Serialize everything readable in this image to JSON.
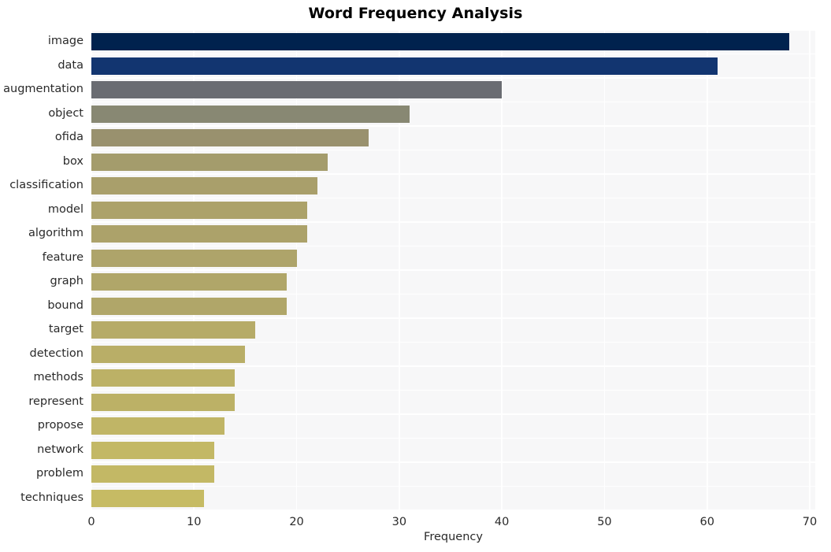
{
  "chart": {
    "title": "Word Frequency Analysis",
    "xlabel": "Frequency",
    "ylabel": ""
  },
  "chart_data": {
    "type": "bar",
    "orientation": "horizontal",
    "title": "Word Frequency Analysis",
    "xlabel": "Frequency",
    "ylabel": "",
    "xlim": [
      0,
      70
    ],
    "xticks": [
      0,
      10,
      20,
      30,
      40,
      50,
      60,
      70
    ],
    "grid": true,
    "legend": null,
    "categories": [
      "image",
      "data",
      "augmentation",
      "object",
      "ofida",
      "box",
      "classification",
      "model",
      "algorithm",
      "feature",
      "graph",
      "bound",
      "target",
      "detection",
      "methods",
      "represent",
      "propose",
      "network",
      "problem",
      "techniques"
    ],
    "values": [
      68,
      61,
      40,
      31,
      27,
      23,
      22,
      21,
      21,
      20,
      19,
      19,
      16,
      15,
      14,
      14,
      13,
      12,
      12,
      11
    ],
    "colors": [
      "#00224e",
      "#123570",
      "#6a6c72",
      "#888873",
      "#99916e",
      "#a49c6c",
      "#a99f6b",
      "#aca26a",
      "#aca26a",
      "#aea46a",
      "#b0a669",
      "#b0a669",
      "#b6ab68",
      "#b9ae67",
      "#bcb166",
      "#bcb166",
      "#c0b566",
      "#c3b865",
      "#c3b865",
      "#c6bb64"
    ],
    "plot_background": "#f7f7f8",
    "gridline_color": "#ffffff"
  }
}
